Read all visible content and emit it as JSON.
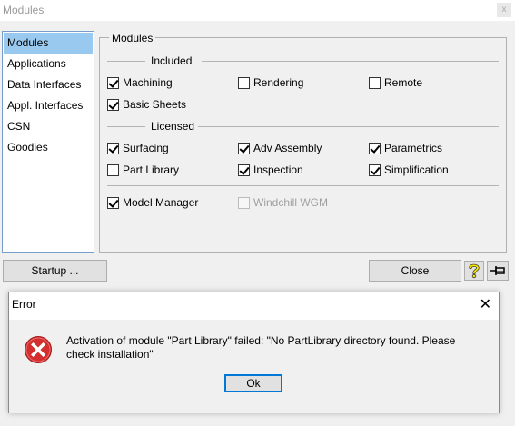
{
  "window": {
    "title": "Modules",
    "close_glyph": "x"
  },
  "sidebar": {
    "items": [
      {
        "label": "Modules",
        "selected": true
      },
      {
        "label": "Applications",
        "selected": false
      },
      {
        "label": "Data Interfaces",
        "selected": false
      },
      {
        "label": "Appl. Interfaces",
        "selected": false
      },
      {
        "label": "CSN",
        "selected": false
      },
      {
        "label": "Goodies",
        "selected": false
      }
    ]
  },
  "modules_group": {
    "legend": "Modules",
    "included_label": "Included",
    "licensed_label": "Licensed",
    "included": [
      {
        "label": "Machining",
        "checked": true
      },
      {
        "label": "Rendering",
        "checked": false
      },
      {
        "label": "Remote",
        "checked": false
      },
      {
        "label": "Basic Sheets",
        "checked": true
      }
    ],
    "licensed": [
      {
        "label": "Surfacing",
        "checked": true
      },
      {
        "label": "Adv Assembly",
        "checked": true
      },
      {
        "label": "Parametrics",
        "checked": true
      },
      {
        "label": "Part Library",
        "checked": false
      },
      {
        "label": "Inspection",
        "checked": true
      },
      {
        "label": "Simplification",
        "checked": true
      }
    ],
    "other": [
      {
        "label": "Model Manager",
        "checked": true,
        "enabled": true
      },
      {
        "label": "Windchill WGM",
        "checked": false,
        "enabled": false
      }
    ]
  },
  "buttons": {
    "startup": "Startup ...",
    "close": "Close",
    "help_icon": "question-icon",
    "pin_icon": "pin-icon"
  },
  "error_dialog": {
    "title": "Error",
    "close_glyph": "✕",
    "message": "Activation of module \"Part Library\" failed: \"No PartLibrary directory found. Please check installation\"",
    "ok": "Ok",
    "icon": "error-icon",
    "icon_color": "#d32f2f"
  }
}
